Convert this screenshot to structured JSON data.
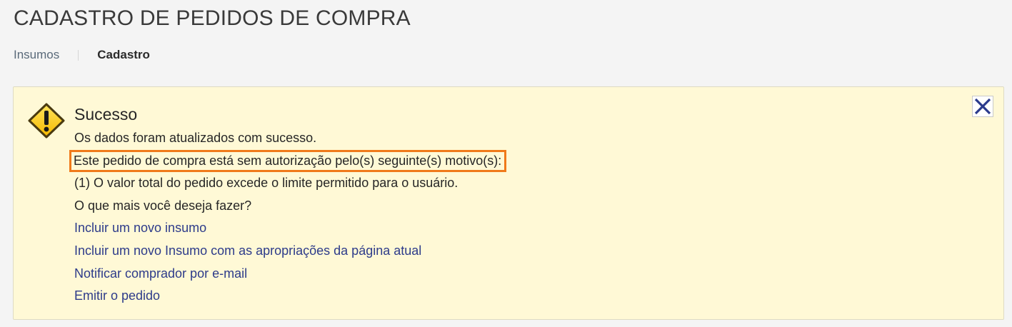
{
  "header": {
    "title": "CADASTRO DE PEDIDOS DE COMPRA"
  },
  "breadcrumb": {
    "items": [
      "Insumos",
      "Cadastro"
    ]
  },
  "alert": {
    "icon": "warning-icon",
    "close_icon": "close-icon",
    "title": "Sucesso",
    "message": "Os dados foram atualizados com sucesso.",
    "highlighted_message": "Este pedido de compra está sem autorização pelo(s) seguinte(s) motivo(s):",
    "reason": "(1) O valor total do pedido excede o limite permitido para o usuário.",
    "question": "O que mais você deseja fazer?",
    "actions": [
      "Incluir um novo insumo",
      "Incluir um novo Insumo com as apropriações da página atual",
      "Notificar comprador por e-mail",
      "Emitir o pedido"
    ]
  },
  "colors": {
    "alert_background": "#fff9d6",
    "highlight_border": "#f07a1a",
    "link": "#2d3b8a",
    "close_icon": "#2a3a8c"
  }
}
